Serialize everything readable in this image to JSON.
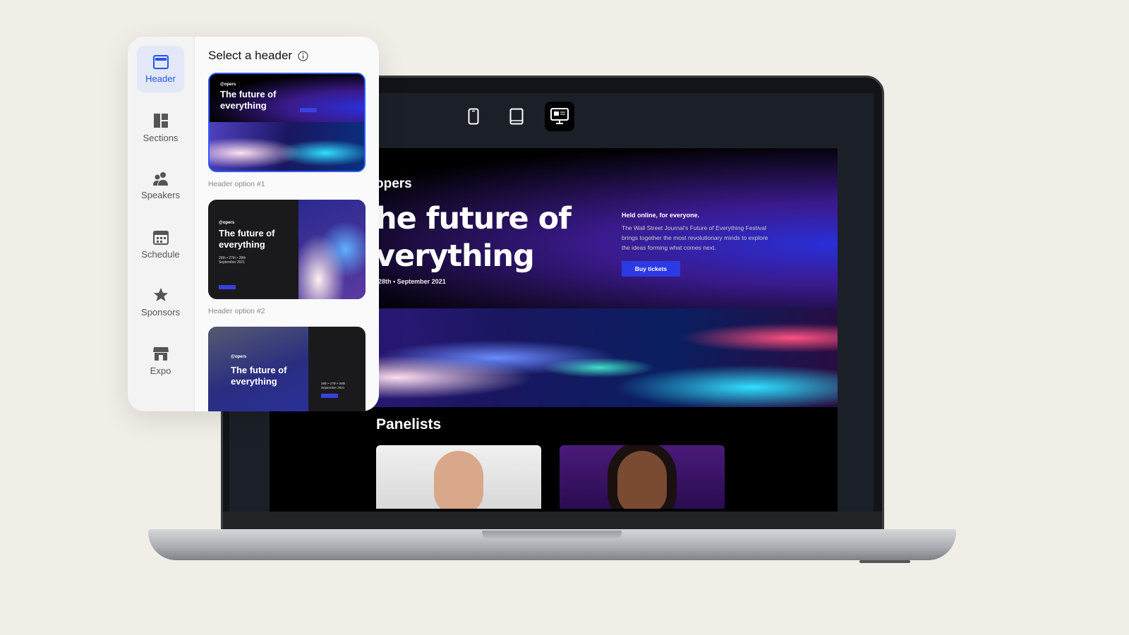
{
  "panel": {
    "title": "Select a header",
    "nav": [
      {
        "label": "Header",
        "icon": "header-layout-icon",
        "active": true
      },
      {
        "label": "Sections",
        "icon": "sections-grid-icon"
      },
      {
        "label": "Speakers",
        "icon": "people-icon"
      },
      {
        "label": "Schedule",
        "icon": "calendar-icon"
      },
      {
        "label": "Sponsors",
        "icon": "star-badge-icon"
      },
      {
        "label": "Expo",
        "icon": "storefront-icon"
      }
    ],
    "options": [
      {
        "label": "Header option #1",
        "logo": "@opers",
        "title_l1": "The future of",
        "title_l2": "everything",
        "selected": true
      },
      {
        "label": "Header option #2",
        "logo": "@opers",
        "title_l1": "The future of",
        "title_l2": "everything",
        "date": "26th • 27th • 28th September 2021"
      },
      {
        "logo": "@opers",
        "title_l1": "The future of",
        "title_l2": "everything",
        "date": "26th • 27th • 28th September 2021"
      }
    ]
  },
  "devices": [
    "mobile-icon",
    "tablet-icon",
    "desktop-icon"
  ],
  "preview": {
    "logo": "opers",
    "title_l1": "he future of",
    "title_l2": "verything",
    "date": "28th • September 2021",
    "held": "Held online, for everyone.",
    "description": "The Wall Street Journal's Future of Everything Festival brings together the most revolutionary minds to explore the ideas forming what comes next.",
    "buy_label": "Buy tickets",
    "panelists_heading": "Panelists"
  },
  "colors": {
    "accent": "#2456e8",
    "button": "#2c3ae6",
    "background": "#f1eee8"
  }
}
